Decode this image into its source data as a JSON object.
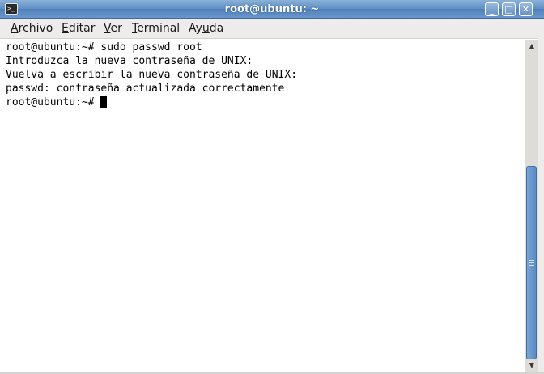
{
  "window": {
    "title": "root@ubuntu: ~",
    "icon": "terminal-icon",
    "controls": {
      "minimize_glyph": "_",
      "maximize_glyph": "□",
      "close_glyph": "✕"
    }
  },
  "menubar": {
    "items": [
      {
        "label_underlined": "A",
        "label_rest": "rchivo"
      },
      {
        "label_underlined": "E",
        "label_rest": "ditar"
      },
      {
        "label_underlined": "V",
        "label_rest": "er"
      },
      {
        "label_underlined": "T",
        "label_rest": "erminal"
      },
      {
        "label_pre": "Ay",
        "label_underlined": "u",
        "label_rest": "da"
      }
    ]
  },
  "terminal": {
    "lines": [
      "root@ubuntu:~# sudo passwd root",
      "Introduzca la nueva contraseña de UNIX:",
      "Vuelva a escribir la nueva contraseña de UNIX:",
      "passwd: contraseña actualizada correctamente"
    ],
    "prompt": "root@ubuntu:~# "
  },
  "scrollbar": {
    "up_glyph": "▲",
    "down_glyph": "▼",
    "thumb_start_fraction": 0.37,
    "thumb_end_fraction": 1.0
  }
}
